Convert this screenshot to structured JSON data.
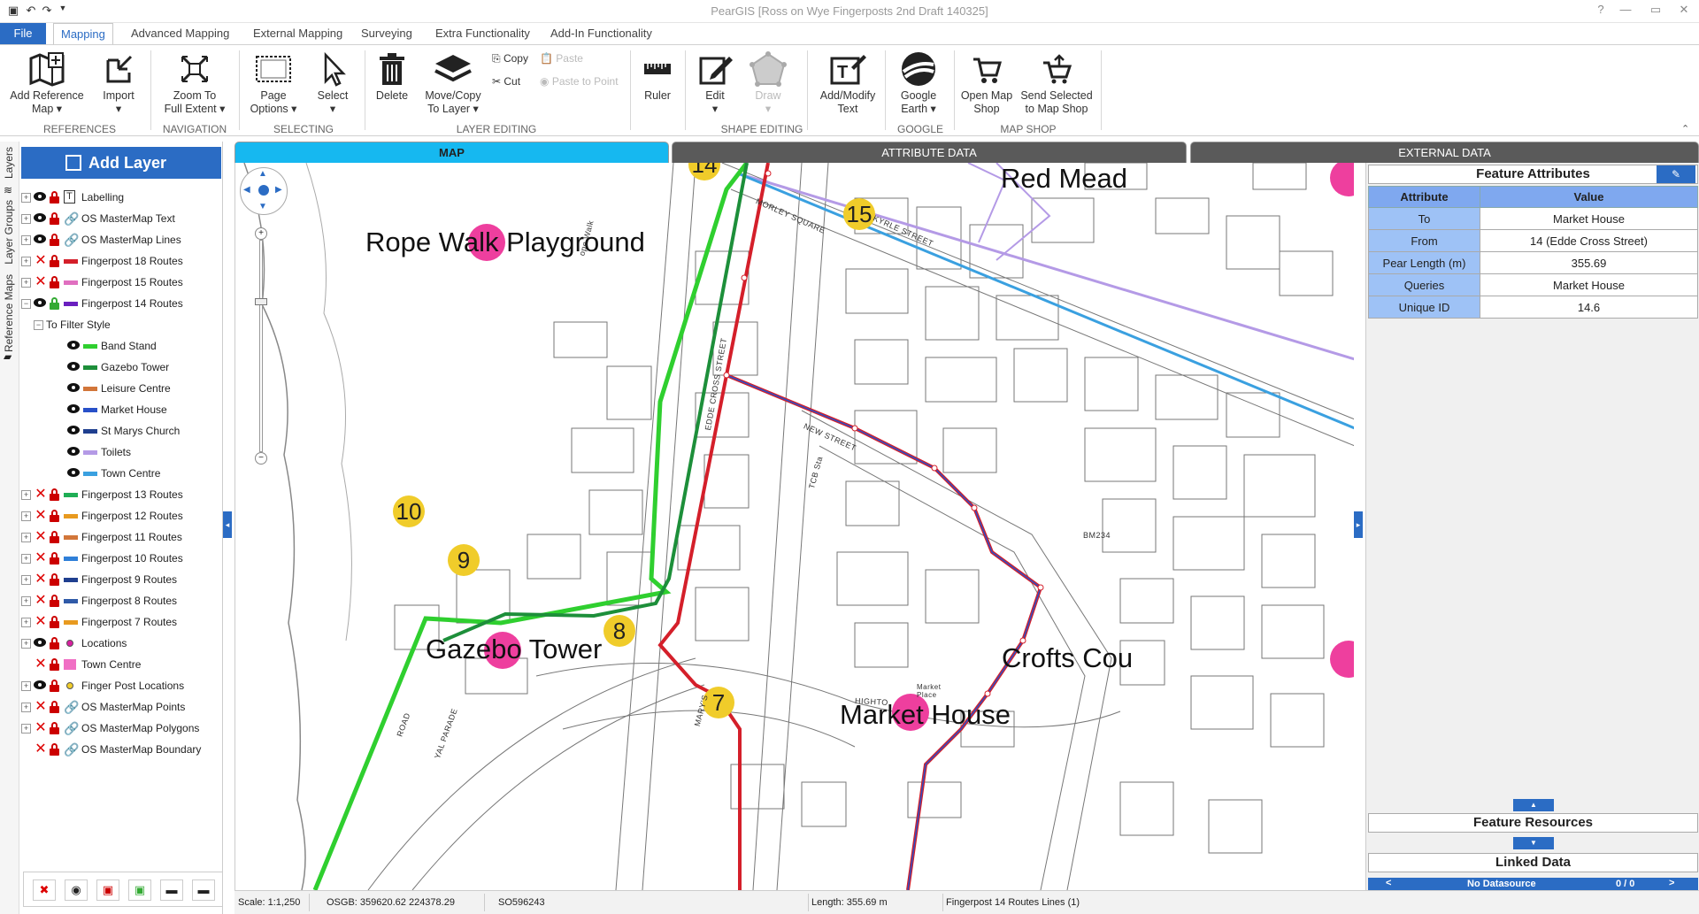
{
  "window": {
    "title": "PearGIS [Ross on Wye Fingerposts 2nd Draft 140325]"
  },
  "ribbon_tabs": [
    "File",
    "Mapping",
    "Advanced Mapping",
    "External Mapping",
    "Surveying",
    "Extra Functionality",
    "Add-In Functionality"
  ],
  "ribbon": {
    "add_reference_map": "Add Reference\nMap ▾",
    "import": "Import\n▾",
    "zoom_to_full_extent": "Zoom To\nFull Extent ▾",
    "page_options": "Page\nOptions ▾",
    "select": "Select\n▾",
    "delete": "Delete",
    "move_copy": "Move/Copy\nTo Layer ▾",
    "copy": "Copy",
    "cut": "Cut",
    "paste": "Paste",
    "paste_to_point": "Paste to Point",
    "ruler": "Ruler",
    "edit": "Edit\n▾",
    "draw": "Draw\n▾",
    "add_modify_text": "Add/Modify\nText",
    "google_earth": "Google\nEarth ▾",
    "open_map_shop": "Open Map\nShop",
    "send_selected": "Send Selected\nto Map Shop",
    "groups": {
      "references": "REFERENCES",
      "navigation": "NAVIGATION",
      "selecting": "SELECTING",
      "layer_editing": "LAYER EDITING",
      "shape_editing": "SHAPE EDITING",
      "google": "GOOGLE",
      "map_shop": "MAP SHOP"
    }
  },
  "left_strip": {
    "layers": "Layers",
    "layer_groups": "Layer Groups",
    "reference_maps": "Reference Maps"
  },
  "layer_panel": {
    "add_layer": "Add Layer",
    "layers": [
      {
        "name": "Labelling",
        "lockColor": "#c00",
        "swatch": "label",
        "visible": true
      },
      {
        "name": "OS MasterMap Text",
        "lockColor": "#c00",
        "swatch": "chain",
        "visible": true
      },
      {
        "name": "OS MasterMap Lines",
        "lockColor": "#c00",
        "swatch": "chain",
        "visible": true
      },
      {
        "name": "Fingerpost 18 Routes",
        "lockColor": "#c00",
        "swatch": "#d41f2a",
        "visible": false
      },
      {
        "name": "Fingerpost 15 Routes",
        "lockColor": "#c00",
        "swatch": "#e06fc0",
        "visible": false
      },
      {
        "name": "Fingerpost 14 Routes",
        "lockColor": "#3a3",
        "swatch": "#6a1fbf",
        "visible": true,
        "expanded": true
      },
      {
        "name": "To Filter Style",
        "indent": 1,
        "expanded": true,
        "noicons": true
      },
      {
        "name": "Band Stand",
        "indent": 2,
        "swatch": "#2fcf2f",
        "subitem": true
      },
      {
        "name": "Gazebo Tower",
        "indent": 2,
        "swatch": "#1d8f3a",
        "subitem": true
      },
      {
        "name": "Leisure Centre",
        "indent": 2,
        "swatch": "#d2763a",
        "subitem": true
      },
      {
        "name": "Market House",
        "indent": 2,
        "swatch": "#2850c8",
        "subitem": true
      },
      {
        "name": "St Marys Church",
        "indent": 2,
        "swatch": "#1f3f8f",
        "subitem": true
      },
      {
        "name": "Toilets",
        "indent": 2,
        "swatch": "#b49ae6",
        "subitem": true
      },
      {
        "name": "Town Centre",
        "indent": 2,
        "swatch": "#3aa0e0",
        "subitem": true
      },
      {
        "name": "Fingerpost 13 Routes",
        "lockColor": "#c00",
        "swatch": "#1fae55",
        "visible": false
      },
      {
        "name": "Fingerpost 12 Routes",
        "lockColor": "#c00",
        "swatch": "#e89a1f",
        "visible": false
      },
      {
        "name": "Fingerpost 11 Routes",
        "lockColor": "#c00",
        "swatch": "#d2763a",
        "visible": false
      },
      {
        "name": "Fingerpost 10 Routes",
        "lockColor": "#c00",
        "swatch": "#2f7fd8",
        "visible": false
      },
      {
        "name": "Fingerpost 9 Routes",
        "lockColor": "#c00",
        "swatch": "#1f3f8f",
        "visible": false
      },
      {
        "name": "Fingerpost 8 Routes",
        "lockColor": "#c00",
        "swatch": "#2f5aa8",
        "visible": false
      },
      {
        "name": "Fingerpost 7 Routes",
        "lockColor": "#c00",
        "swatch": "#e89a1f",
        "visible": false
      },
      {
        "name": "Locations",
        "lockColor": "#c00",
        "swatch": "dot-pink",
        "visible": true
      },
      {
        "name": "Town Centre",
        "lockColor": "#c00",
        "swatch": "#f06fc4",
        "visible": false,
        "nobox": true,
        "big": true
      },
      {
        "name": "Finger Post Locations",
        "lockColor": "#c00",
        "swatch": "dot-yellow",
        "visible": true
      },
      {
        "name": "OS MasterMap Points",
        "lockColor": "#c00",
        "swatch": "chain",
        "visible": false
      },
      {
        "name": "OS MasterMap Polygons",
        "lockColor": "#c00",
        "swatch": "chain",
        "visible": false
      },
      {
        "name": "OS MasterMap Boundary",
        "lockColor": "#c00",
        "swatch": "chain",
        "visible": false,
        "nobox": true
      }
    ]
  },
  "view_tabs": {
    "map": "MAP",
    "attribute_data": "ATTRIBUTE DATA",
    "external_data": "EXTERNAL DATA"
  },
  "map": {
    "labels": {
      "rope_walk": "Rope Walk Playground",
      "gazebo": "Gazebo Tower",
      "red_mead": "Red Mead",
      "crofts": "Crofts Cou",
      "market_house": "Market House"
    },
    "pins": {
      "p14": "14",
      "p15": "15",
      "p10": "10",
      "p9": "9",
      "p8": "8",
      "p7": "7"
    },
    "streets": {
      "morley": "MORLEY SQUARE",
      "kyrle": "KYRLE STREET",
      "edde": "EDDE CROSS STREET",
      "new": "NEW STREET",
      "rope": "ope Walk",
      "high": "HIGHTO",
      "road": "ROAD",
      "royal": "YAL PARADE",
      "marys": "MARY'S",
      "tcb": "TCB Sta",
      "code": "BM234",
      "market_small": "Market\nPlace"
    }
  },
  "status": {
    "scale": "Scale: 1:1,250",
    "osgb": "OSGB:  359620.62   224378.29",
    "grid": "SO596243",
    "length": "Length: 355.69 m",
    "layer": "Fingerpost 14 Routes Lines (1)"
  },
  "feature_panel": {
    "title": "Feature Attributes",
    "col_attribute": "Attribute",
    "col_value": "Value",
    "rows": [
      {
        "k": "To",
        "v": "Market House"
      },
      {
        "k": "From",
        "v": "14 (Edde Cross Street)"
      },
      {
        "k": "Pear Length (m)",
        "v": "355.69"
      },
      {
        "k": "Queries",
        "v": "Market House"
      },
      {
        "k": "Unique ID",
        "v": "14.6"
      }
    ],
    "feature_resources": "Feature Resources",
    "linked_data": "Linked Data",
    "no_datasource": "No Datasource",
    "record_count": "0 / 0"
  }
}
